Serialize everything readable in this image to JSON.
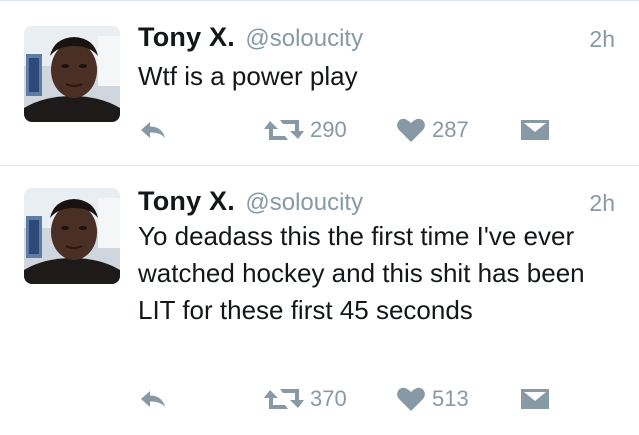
{
  "tweets": [
    {
      "display_name": "Tony X.",
      "handle": "@soloucity",
      "time": "2h",
      "text": "Wtf is a power play",
      "retweets": "290",
      "likes": "287"
    },
    {
      "display_name": "Tony X.",
      "handle": "@soloucity",
      "time": "2h",
      "text": "Yo deadass this the first time I've ever watched hockey and this shit has been LIT for these first 45 seconds",
      "retweets": "370",
      "likes": "513"
    }
  ],
  "icons": {
    "reply": "reply-arrow-icon",
    "retweet": "retweet-icon",
    "like": "heart-icon",
    "message": "envelope-icon"
  },
  "colors": {
    "text": "#14171a",
    "muted": "#8899a6",
    "divider": "#e1e8ed",
    "background": "#ffffff"
  }
}
